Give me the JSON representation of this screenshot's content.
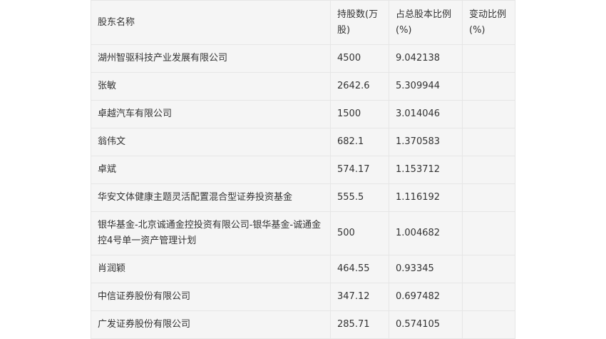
{
  "table": {
    "headers": [
      "股东名称",
      "持股数(万股)",
      "占总股本比例(%)",
      "变动比例(%)"
    ],
    "rows": [
      {
        "name": "湖州智驱科技产业发展有限公司",
        "shares": "4500",
        "ratio": "9.042138",
        "change": ""
      },
      {
        "name": "张敏",
        "shares": "2642.6",
        "ratio": "5.309944",
        "change": ""
      },
      {
        "name": "卓越汽车有限公司",
        "shares": "1500",
        "ratio": "3.014046",
        "change": ""
      },
      {
        "name": "翁伟文",
        "shares": "682.1",
        "ratio": "1.370583",
        "change": ""
      },
      {
        "name": "卓斌",
        "shares": "574.17",
        "ratio": "1.153712",
        "change": ""
      },
      {
        "name": "华安文体健康主题灵活配置混合型证券投资基金",
        "shares": "555.5",
        "ratio": "1.116192",
        "change": ""
      },
      {
        "name": "银华基金-北京诚通金控投资有限公司-银华基金-诚通金控4号单一资产管理计划",
        "shares": "500",
        "ratio": "1.004682",
        "change": ""
      },
      {
        "name": "肖润颖",
        "shares": "464.55",
        "ratio": "0.93345",
        "change": ""
      },
      {
        "name": "中信证券股份有限公司",
        "shares": "347.12",
        "ratio": "0.697482",
        "change": ""
      },
      {
        "name": "广发证券股份有限公司",
        "shares": "285.71",
        "ratio": "0.574105",
        "change": ""
      }
    ]
  }
}
